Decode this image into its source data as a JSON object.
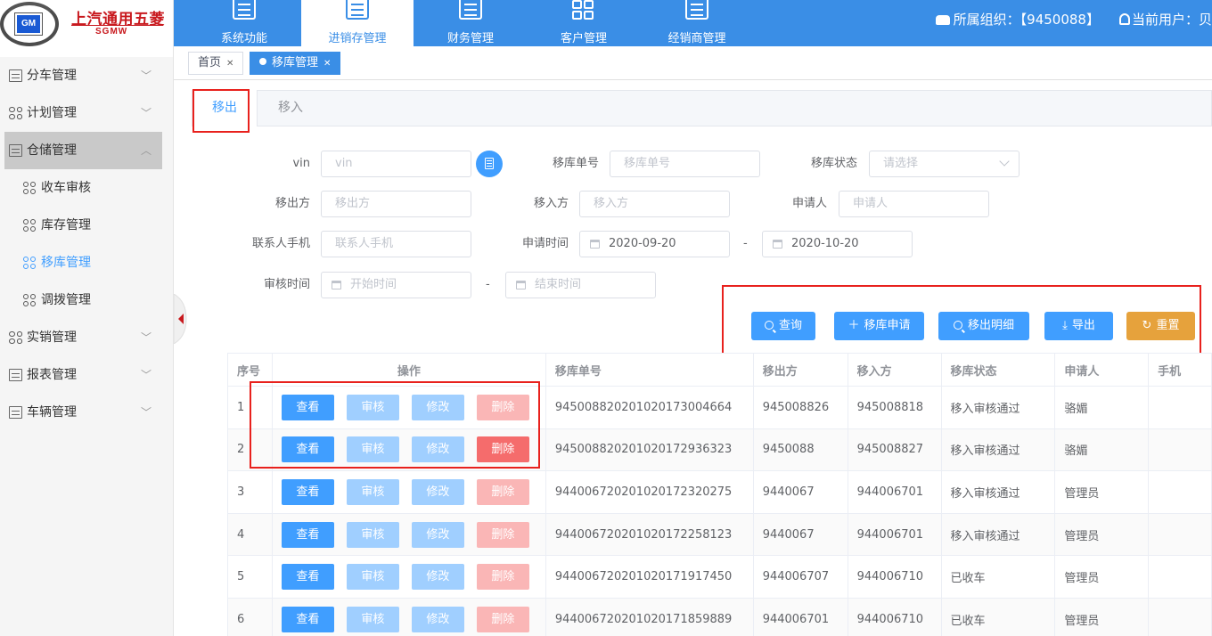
{
  "brand": {
    "cn": "上汽通用五菱",
    "en": "SGMW",
    "emblem": "GM"
  },
  "sidebar": {
    "items": [
      {
        "label": "分车管理",
        "icon": "list-icon"
      },
      {
        "label": "计划管理",
        "icon": "grid-icon"
      },
      {
        "label": "仓储管理",
        "icon": "list-icon",
        "active": true
      },
      {
        "label": "实销管理",
        "icon": "copy-icon"
      },
      {
        "label": "报表管理",
        "icon": "list-icon"
      },
      {
        "label": "车辆管理",
        "icon": "list-icon"
      }
    ],
    "sub_items": [
      {
        "label": "收车审核"
      },
      {
        "label": "库存管理"
      },
      {
        "label": "移库管理",
        "current": true
      },
      {
        "label": "调拨管理"
      }
    ]
  },
  "topnav": {
    "tabs": [
      {
        "label": "系统功能"
      },
      {
        "label": "进销存管理",
        "active": true
      },
      {
        "label": "财务管理"
      },
      {
        "label": "客户管理"
      },
      {
        "label": "经销商管理"
      }
    ],
    "org_label": "所属组织：【9450088】",
    "user_label": "当前用户：贝"
  },
  "page_tabs": [
    {
      "label": "首页"
    },
    {
      "label": "移库管理",
      "active": true
    }
  ],
  "card_tabs": [
    {
      "label": "移出",
      "active": true
    },
    {
      "label": "移入"
    }
  ],
  "form": {
    "vin": {
      "label": "vin",
      "placeholder": "vin"
    },
    "order_no": {
      "label": "移库单号",
      "placeholder": "移库单号"
    },
    "status": {
      "label": "移库状态",
      "placeholder": "请选择"
    },
    "from": {
      "label": "移出方",
      "placeholder": "移出方"
    },
    "to": {
      "label": "移入方",
      "placeholder": "移入方"
    },
    "applicant": {
      "label": "申请人",
      "placeholder": "申请人"
    },
    "phone": {
      "label": "联系人手机",
      "placeholder": "联系人手机"
    },
    "apply_time": {
      "label": "申请时间",
      "start": "2020-09-20",
      "end": "2020-10-20"
    },
    "audit_time": {
      "label": "审核时间",
      "start_placeholder": "开始时间",
      "end_placeholder": "结束时间"
    },
    "range_sep": "-"
  },
  "actions": {
    "query": "查询",
    "apply": "移库申请",
    "detail": "移出明细",
    "export": "导出",
    "reset": "重置"
  },
  "table": {
    "headers": [
      "序号",
      "操作",
      "移库单号",
      "移出方",
      "移入方",
      "移库状态",
      "申请人",
      "手机"
    ],
    "row_buttons": {
      "view": "查看",
      "audit": "审核",
      "edit": "修改",
      "delete": "删除"
    },
    "rows": [
      {
        "no": "1",
        "order": "945008820201020173004664",
        "from": "945008826",
        "to": "945008818",
        "status": "移入审核通过",
        "applicant": "骆媚",
        "phone": "",
        "delete_enabled": false
      },
      {
        "no": "2",
        "order": "945008820201020172936323",
        "from": "9450088",
        "to": "945008827",
        "status": "移入审核通过",
        "applicant": "骆媚",
        "phone": "",
        "delete_enabled": true
      },
      {
        "no": "3",
        "order": "944006720201020172320275",
        "from": "9440067",
        "to": "944006701",
        "status": "移入审核通过",
        "applicant": "管理员",
        "phone": "",
        "delete_enabled": false
      },
      {
        "no": "4",
        "order": "944006720201020172258123",
        "from": "9440067",
        "to": "944006701",
        "status": "移入审核通过",
        "applicant": "管理员",
        "phone": "",
        "delete_enabled": false
      },
      {
        "no": "5",
        "order": "944006720201020171917450",
        "from": "944006707",
        "to": "944006710",
        "status": "已收车",
        "applicant": "管理员",
        "phone": "",
        "delete_enabled": false
      },
      {
        "no": "6",
        "order": "944006720201020171859889",
        "from": "944006701",
        "to": "944006710",
        "status": "已收车",
        "applicant": "管理员",
        "phone": "",
        "delete_enabled": false
      }
    ]
  },
  "colors": {
    "primary": "#409eff",
    "topbar": "#3a8ee6",
    "warning": "#e6a23c",
    "danger": "#f56c6c",
    "annotation": "#e8211d"
  }
}
